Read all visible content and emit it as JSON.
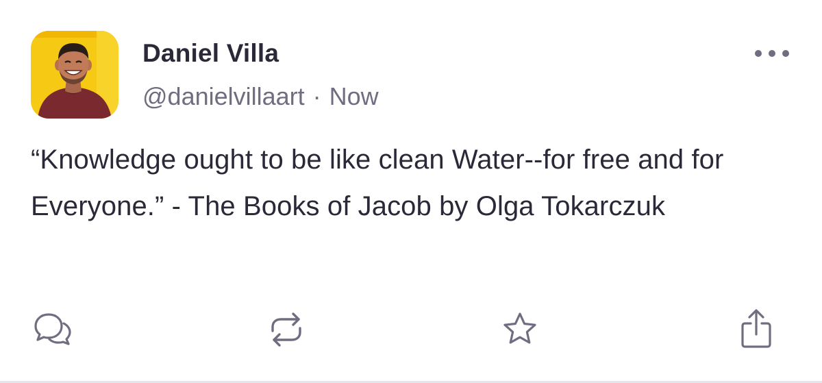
{
  "post": {
    "author": {
      "display_name": "Daniel Villa",
      "handle": "@danielvillaart",
      "separator": "·",
      "timestamp": "Now"
    },
    "text": "“Knowledge ought to be like clean Water--for free and for Everyone.” - The Books of Jacob by Olga Tokarczuk",
    "actions": [
      {
        "name": "reply",
        "icon": "speech-bubbles-icon"
      },
      {
        "name": "repost",
        "icon": "repeat-arrows-icon"
      },
      {
        "name": "favorite",
        "icon": "star-icon"
      },
      {
        "name": "share",
        "icon": "share-up-arrow-icon"
      }
    ],
    "more_icon": "ellipsis-icon"
  },
  "colors": {
    "text_primary": "#2b2838",
    "text_secondary": "#6f6d80",
    "icon": "#6f6d80",
    "avatar_background": "#f6c915",
    "divider": "#e6e6ea"
  }
}
